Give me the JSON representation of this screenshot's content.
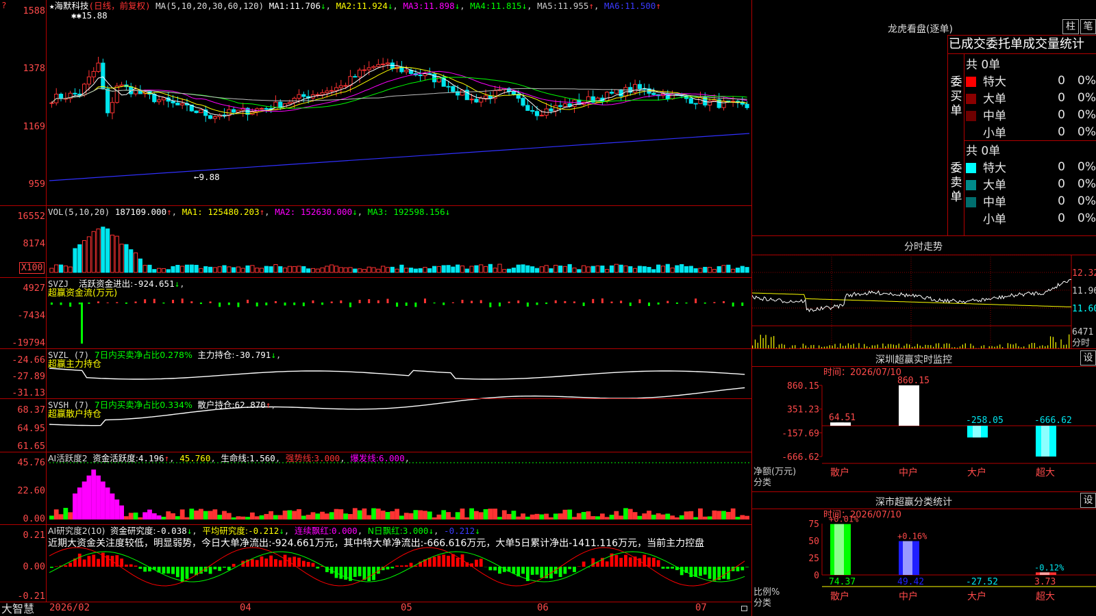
{
  "stock": {
    "name": "海默科技",
    "mode": "(日线，前复权)",
    "star": "★"
  },
  "colors": {
    "up": "#ff3232",
    "down": "#00e5ee",
    "ma1": "#ffffff",
    "ma2": "#ffff00",
    "ma3": "#ff00ff",
    "ma4": "#00ff00",
    "ma5": "#c0c0c0",
    "ma6": "#3030ff",
    "axis": "#ff4a4a",
    "frame": "#b40000"
  },
  "price_panel": {
    "indicator": "MA(5,10,20,30,60,120)",
    "ma_values": [
      {
        "label": "MA1:",
        "value": "11.706",
        "arrow": "↓"
      },
      {
        "label": "MA2:",
        "value": "11.924",
        "arrow": "↓"
      },
      {
        "label": "MA3:",
        "value": "11.898",
        "arrow": "↓"
      },
      {
        "label": "MA4:",
        "value": "11.815",
        "arrow": "↓"
      },
      {
        "label": "MA5:",
        "value": "11.955",
        "arrow": "↑"
      },
      {
        "label": "MA6:",
        "value": "11.500",
        "arrow": "↑"
      }
    ],
    "y_ticks": [
      "1588",
      "1378",
      "1169",
      "959"
    ],
    "high_label": "15.88",
    "low_label": "←9.88",
    "corner_mark": "?"
  },
  "volume_panel": {
    "indicator": "VOL(5,10,20)",
    "value": "187109.000",
    "value_arrow": "↑",
    "ma": [
      {
        "label": "MA1:",
        "value": "125480.203",
        "arrow": "↑"
      },
      {
        "label": "MA2:",
        "value": "152630.000",
        "arrow": "↓"
      },
      {
        "label": "MA3:",
        "value": "192598.156",
        "arrow": "↓"
      }
    ],
    "y_ticks": [
      "16552",
      "8174"
    ],
    "unit": "X100"
  },
  "svzj_panel": {
    "indicator": "SVZJ",
    "label": "活跃资金进出:",
    "value": "-924.651",
    "arrow": "↓",
    "subtitle": "超赢资金流(万元)",
    "y_ticks": [
      "4927",
      "-7434",
      "-19794"
    ]
  },
  "svzl_panel": {
    "indicator": "SVZL (7)",
    "ratio_text": "7日内买卖净占比0.278%",
    "label": "主力持仓:",
    "value": "-30.791",
    "arrow": "↓",
    "subtitle": "超赢主力持仓",
    "y_ticks": [
      "-24.66",
      "-27.89",
      "-31.13"
    ]
  },
  "svsh_panel": {
    "indicator": "SVSH (7)",
    "ratio_text": "7日内买卖净占比0.334%",
    "label": "散户持仓:",
    "value": "62.870",
    "arrow": "↑",
    "subtitle": "超赢散户持仓",
    "y_ticks": [
      "68.37",
      "64.95",
      "61.65"
    ]
  },
  "ai_active_panel": {
    "indicator": "AI活跃度2",
    "items": [
      {
        "label": "资金活跃度:",
        "value": "4.196",
        "arrow": "↑"
      },
      {
        "label": "",
        "value": "45.760",
        "arrow": ""
      },
      {
        "label": "生命线:",
        "value": "1.560",
        "arrow": ""
      },
      {
        "label": "强势线:",
        "value": "3.000",
        "arrow": ""
      },
      {
        "label": "爆发线:",
        "value": "6.000",
        "arrow": ""
      }
    ],
    "y_ticks": [
      "45.76",
      "22.60",
      "0.00"
    ]
  },
  "ai_research_panel": {
    "indicator": "AI研究度2(10)",
    "items": [
      {
        "label": "资金研究度:",
        "value": "-0.038",
        "arrow": "↓"
      },
      {
        "label": "平均研究度:",
        "value": "-0.212",
        "arrow": "↓"
      },
      {
        "label": "连续飘红:",
        "value": "0.000",
        "arrow": ""
      },
      {
        "label": "N日飘红:",
        "value": "3.000",
        "arrow": "↓"
      },
      {
        "label": "",
        "value": "-0.212",
        "arrow": "↓"
      }
    ],
    "commentary": "近期大资金关注度较低，明显弱势，今日大单净流出:-924.661万元，其中特大单净流出:-666.616万元，大单5日累计净出-1411.116万元，当前主力控盘",
    "y_ticks": [
      "0.21",
      "0.00",
      "-0.21"
    ]
  },
  "x_axis": {
    "brand": "大智慧",
    "labels": [
      "2026/02",
      "04",
      "05",
      "06",
      "07"
    ]
  },
  "longhu": {
    "title": "龙虎看盘(逐单)",
    "btn_bar": "柱",
    "btn_pen": "笔",
    "header": "已成交委托单成交量统计",
    "buy_label": "委买单",
    "sell_label": "委卖单",
    "buy_total": "共 0单",
    "sell_total": "共 0单",
    "buy_rows": [
      {
        "name": "特大",
        "count": "0",
        "pct": "0%",
        "color": "#ff0000"
      },
      {
        "name": "大单",
        "count": "0",
        "pct": "0%",
        "color": "#8b0000"
      },
      {
        "name": "中单",
        "count": "0",
        "pct": "0%",
        "color": "#6e0000"
      },
      {
        "name": "小单",
        "count": "0",
        "pct": "0%",
        "color": ""
      }
    ],
    "sell_rows": [
      {
        "name": "特大",
        "count": "0",
        "pct": "0%",
        "color": "#00ffff"
      },
      {
        "name": "大单",
        "count": "0",
        "pct": "0%",
        "color": "#008b8b"
      },
      {
        "name": "中单",
        "count": "0",
        "pct": "0%",
        "color": "#006e6e"
      },
      {
        "name": "小单",
        "count": "0",
        "pct": "0%",
        "color": ""
      }
    ]
  },
  "intraday": {
    "title": "分时走势",
    "y_ticks": [
      "12.32",
      "11.96",
      "11.60"
    ],
    "vol_tick": "6471",
    "vol_unit": "分时"
  },
  "sz_monitor": {
    "title": "深圳超赢实时监控",
    "settings": "设",
    "date_label": "时间：2026/07/10",
    "y_ticks": [
      "860.15",
      "351.23",
      "-157.69",
      "-666.62"
    ],
    "unit_label": "净额(万元)",
    "class_label": "分类",
    "chart_data": {
      "type": "bar",
      "categories": [
        "散户",
        "中户",
        "大户",
        "超大"
      ],
      "values": [
        64.51,
        860.15,
        -258.05,
        -666.62
      ],
      "value_labels": [
        "64.51",
        "860.15",
        "-258.05",
        "-666.62"
      ],
      "ylim": [
        -666.62,
        860.15
      ]
    }
  },
  "sz_class": {
    "title": "深市超赢分类统计",
    "settings": "设",
    "date_label": "时间：2026/07/10",
    "y_ticks": [
      "75",
      "50",
      "25",
      "0"
    ],
    "unit_label": "比例%",
    "class_label": "分类",
    "chart_data": {
      "type": "bar",
      "categories": [
        "散户",
        "中户",
        "大户",
        "超大"
      ],
      "values": [
        74.37,
        49.42,
        -27.52,
        3.73
      ],
      "value_labels": [
        "74.37",
        "49.42",
        "-27.52",
        "3.73"
      ],
      "change_labels": [
        "+0.01%",
        "+0.16%",
        "",
        "-0.12%"
      ],
      "ylim": [
        0,
        75
      ]
    }
  }
}
